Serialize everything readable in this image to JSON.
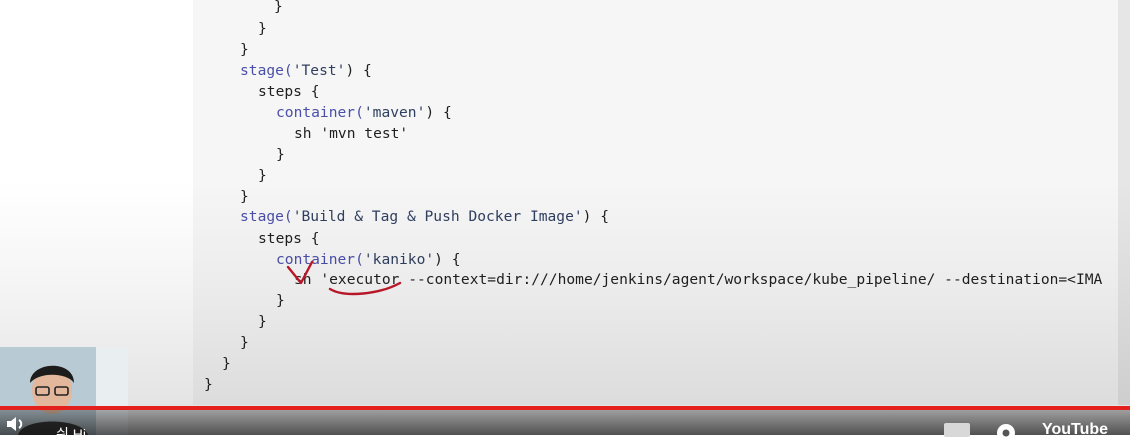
{
  "code": {
    "lines": [
      {
        "indent": 40,
        "text": "}"
      },
      {
        "indent": 32,
        "text": "}"
      },
      {
        "indent": 24,
        "text": "}"
      },
      {
        "indent": 24,
        "prefix": "stage(",
        "str": "'Test'",
        "suffix": ") {"
      },
      {
        "indent": 32,
        "text": "steps {"
      },
      {
        "indent": 40,
        "prefix": "container(",
        "str": "'maven'",
        "suffix": ") {"
      },
      {
        "indent": 48,
        "text": "sh 'mvn test'"
      },
      {
        "indent": 40,
        "text": "}"
      },
      {
        "indent": 32,
        "text": "}"
      },
      {
        "indent": 24,
        "text": "}"
      },
      {
        "indent": 24,
        "prefix": "stage(",
        "str": "'Build & Tag & Push Docker Image'",
        "suffix": ") {"
      },
      {
        "indent": 32,
        "text": "steps {"
      },
      {
        "indent": 40,
        "prefix": "container(",
        "str": "'kaniko'",
        "suffix": ") {"
      },
      {
        "indent": 48,
        "text": "sh 'executor --context=dir:///home/jenkins/agent/workspace/kube_pipeline/ --destination=<IMA"
      },
      {
        "indent": 40,
        "text": "}"
      },
      {
        "indent": 32,
        "text": "}"
      },
      {
        "indent": 24,
        "text": "}"
      },
      {
        "indent": 16,
        "text": "}"
      },
      {
        "indent": 8,
        "text": "}"
      }
    ]
  },
  "player": {
    "progress_color": "#e3201b",
    "partial_caption": "쉬 Hi",
    "youtube_label": "YouTube",
    "icons": [
      "volume-icon",
      "subtitles-icon",
      "settings-gear-icon"
    ]
  },
  "annotation_color": "#c0182a"
}
